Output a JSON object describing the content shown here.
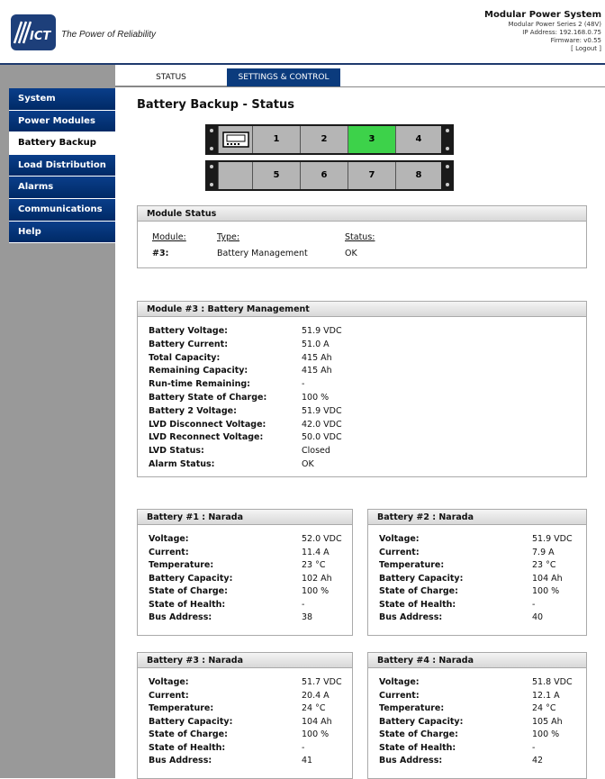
{
  "header": {
    "tagline": "The Power of Reliability",
    "logo_text": "ICT",
    "system_title": "Modular Power System",
    "system_subtitle": "Modular Power Series 2 (48V)",
    "ip_address": "IP Address: 192.168.0.75",
    "firmware": "Firmware: v0.55",
    "logout": "[ Logout ]"
  },
  "tabs": {
    "status": "STATUS",
    "settings": "SETTINGS & CONTROL"
  },
  "nav": [
    "System",
    "Power Modules",
    "Battery Backup",
    "Load Distribution",
    "Alarms",
    "Communications",
    "Help"
  ],
  "page_title": "Battery Backup - Status",
  "shelves": {
    "top": [
      "1",
      "2",
      "3",
      "4"
    ],
    "bottom": [
      "5",
      "6",
      "7",
      "8"
    ],
    "selected": "3"
  },
  "module_status": {
    "title": "Module Status",
    "headers": {
      "module": "Module:",
      "type": "Type:",
      "status": "Status:"
    },
    "row": {
      "module": "#3:",
      "type": "Battery Management",
      "status": "OK"
    }
  },
  "battery_mgmt": {
    "title": "Module #3 : Battery Management",
    "rows": [
      {
        "label": "Battery Voltage:",
        "value": "51.9 VDC"
      },
      {
        "label": "Battery Current:",
        "value": "51.0 A"
      },
      {
        "label": "Total Capacity:",
        "value": "415 Ah"
      },
      {
        "label": "Remaining Capacity:",
        "value": "415 Ah"
      },
      {
        "label": "Run-time Remaining:",
        "value": "-"
      },
      {
        "label": "Battery State of Charge:",
        "value": "100 %"
      },
      {
        "label": "Battery 2 Voltage:",
        "value": "51.9 VDC"
      },
      {
        "label": "LVD Disconnect Voltage:",
        "value": "42.0 VDC"
      },
      {
        "label": "LVD Reconnect Voltage:",
        "value": "50.0 VDC"
      },
      {
        "label": "LVD Status:",
        "value": "Closed"
      },
      {
        "label": "Alarm Status:",
        "value": "OK"
      }
    ]
  },
  "batteries": [
    {
      "title": "Battery #1 : Narada",
      "rows": [
        {
          "label": "Voltage:",
          "value": "52.0 VDC"
        },
        {
          "label": "Current:",
          "value": "11.4 A"
        },
        {
          "label": "Temperature:",
          "value": "23 °C"
        },
        {
          "label": "Battery Capacity:",
          "value": "102 Ah"
        },
        {
          "label": "State of Charge:",
          "value": "100 %"
        },
        {
          "label": "State of Health:",
          "value": "-"
        },
        {
          "label": "Bus Address:",
          "value": "38"
        }
      ]
    },
    {
      "title": "Battery #2 : Narada",
      "rows": [
        {
          "label": "Voltage:",
          "value": "51.9 VDC"
        },
        {
          "label": "Current:",
          "value": "7.9 A"
        },
        {
          "label": "Temperature:",
          "value": "23 °C"
        },
        {
          "label": "Battery Capacity:",
          "value": "104 Ah"
        },
        {
          "label": "State of Charge:",
          "value": "100 %"
        },
        {
          "label": "State of Health:",
          "value": "-"
        },
        {
          "label": "Bus Address:",
          "value": "40"
        }
      ]
    },
    {
      "title": "Battery #3 : Narada",
      "rows": [
        {
          "label": "Voltage:",
          "value": "51.7 VDC"
        },
        {
          "label": "Current:",
          "value": "20.4 A"
        },
        {
          "label": "Temperature:",
          "value": "24 °C"
        },
        {
          "label": "Battery Capacity:",
          "value": "104 Ah"
        },
        {
          "label": "State of Charge:",
          "value": "100 %"
        },
        {
          "label": "State of Health:",
          "value": "-"
        },
        {
          "label": "Bus Address:",
          "value": "41"
        }
      ]
    },
    {
      "title": "Battery #4 : Narada",
      "rows": [
        {
          "label": "Voltage:",
          "value": "51.8 VDC"
        },
        {
          "label": "Current:",
          "value": "12.1 A"
        },
        {
          "label": "Temperature:",
          "value": "24 °C"
        },
        {
          "label": "Battery Capacity:",
          "value": "105 Ah"
        },
        {
          "label": "State of Charge:",
          "value": "100 %"
        },
        {
          "label": "State of Health:",
          "value": "-"
        },
        {
          "label": "Bus Address:",
          "value": "42"
        }
      ]
    }
  ],
  "colors": {
    "nav_blue": "#0a3e8a",
    "selected_bay": "#3dd24a"
  }
}
